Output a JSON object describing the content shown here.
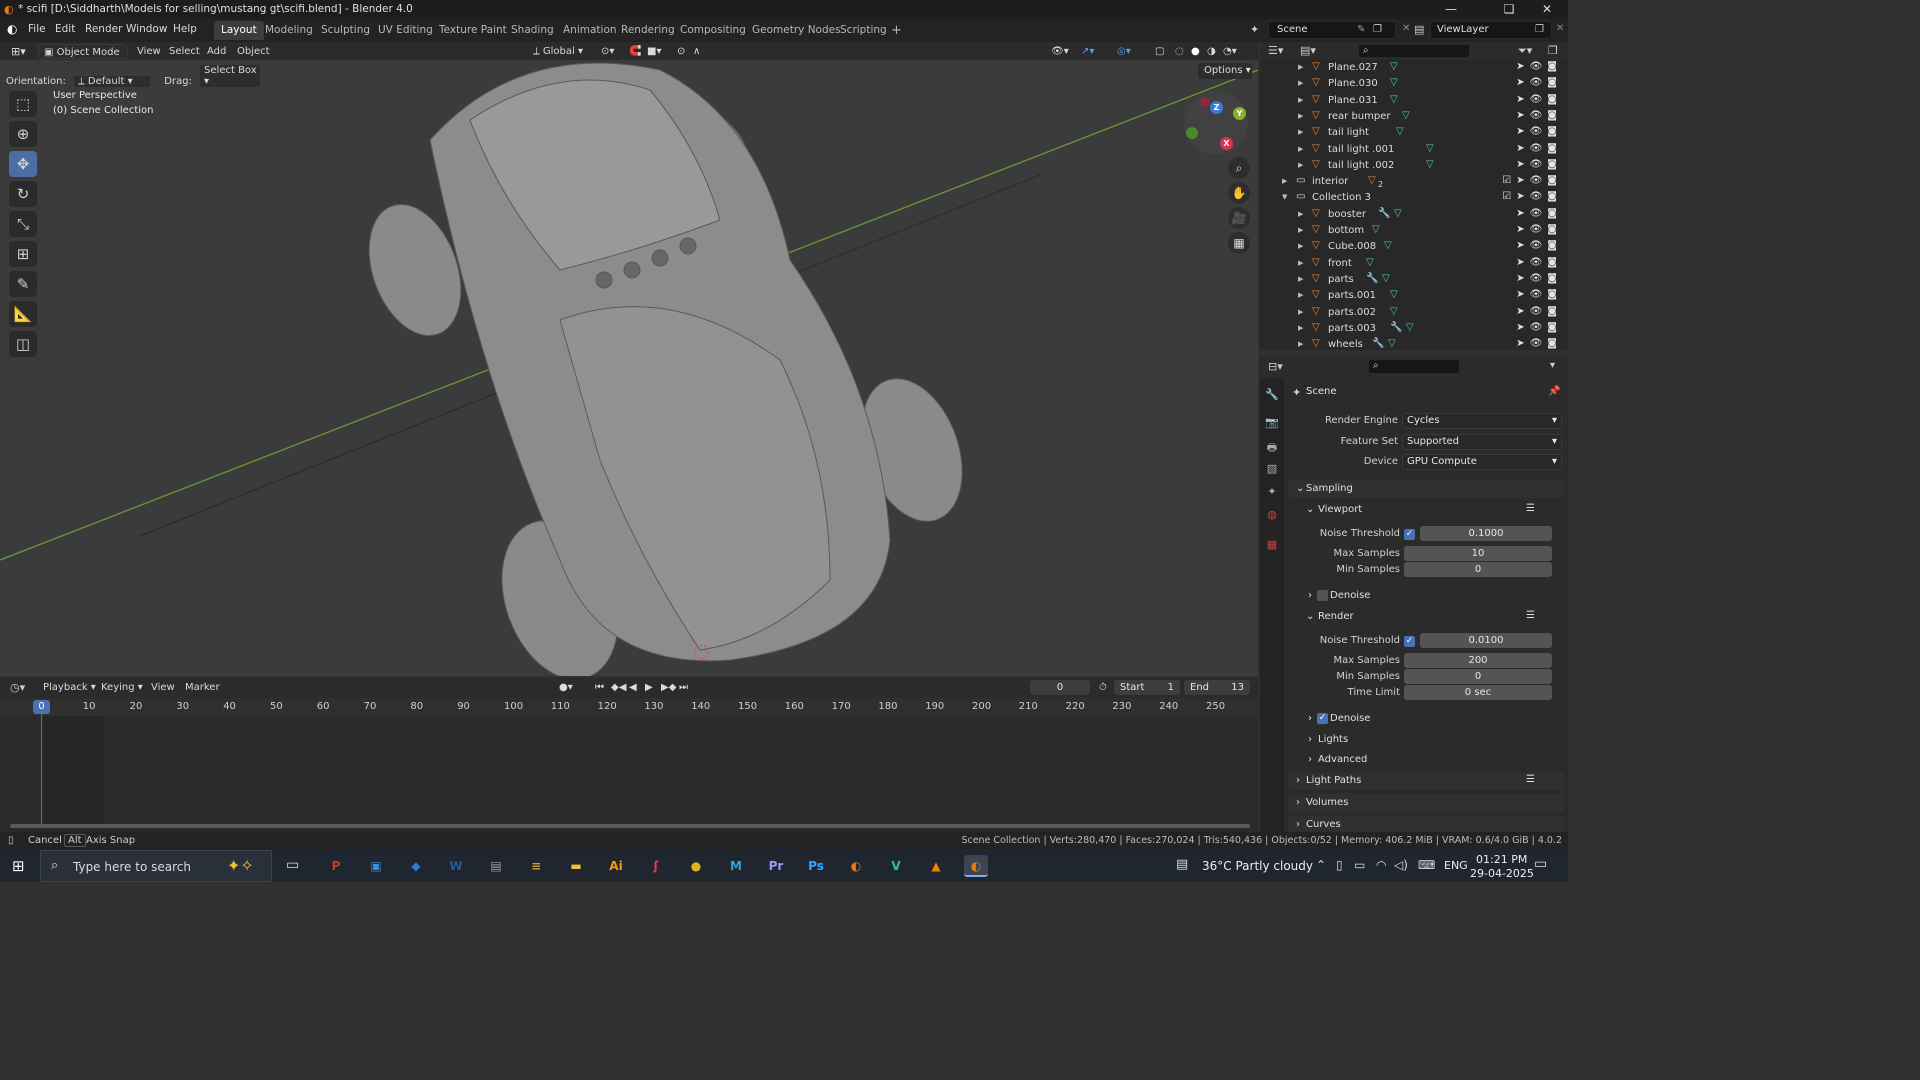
{
  "titlebar": {
    "title": "* scifi [D:\\Siddharth\\Models for selling\\mustang gt\\scifi.blend] - Blender 4.0"
  },
  "menu": {
    "items": [
      "File",
      "Edit",
      "Render",
      "Window",
      "Help"
    ]
  },
  "workspaces": {
    "tabs": [
      "Layout",
      "Modeling",
      "Sculpting",
      "UV Editing",
      "Texture Paint",
      "Shading",
      "Animation",
      "Rendering",
      "Compositing",
      "Geometry Nodes",
      "Scripting"
    ],
    "active": "Layout",
    "add": "+"
  },
  "scene": {
    "name": "Scene",
    "view_layer": "ViewLayer"
  },
  "viewport_header": {
    "mode": "Object Mode",
    "menus": [
      "View",
      "Select",
      "Add",
      "Object"
    ],
    "transform": "Global",
    "orientation_label": "Orientation:",
    "orientation": "Default",
    "drag_label": "Drag:",
    "drag": "Select Box",
    "options": "Options"
  },
  "viewport": {
    "perspective": "User Perspective",
    "collection": "(0) Scene Collection",
    "gizmo": {
      "x": "X",
      "y": "Y",
      "z": "Z"
    }
  },
  "outliner": {
    "rows": [
      {
        "name": "Plane.027",
        "indent": 2,
        "type": "mesh",
        "mod": false,
        "checkbox": false
      },
      {
        "name": "Plane.030",
        "indent": 2,
        "type": "mesh",
        "mod": false,
        "checkbox": false
      },
      {
        "name": "Plane.031",
        "indent": 2,
        "type": "mesh",
        "mod": false,
        "checkbox": false
      },
      {
        "name": "rear bumper",
        "indent": 2,
        "type": "mesh",
        "mod": false,
        "checkbox": false
      },
      {
        "name": "tail light",
        "indent": 2,
        "type": "mesh",
        "mod": false,
        "checkbox": false
      },
      {
        "name": "tail light .001",
        "indent": 2,
        "type": "mesh",
        "mod": false,
        "checkbox": false
      },
      {
        "name": "tail light .002",
        "indent": 2,
        "type": "mesh",
        "mod": false,
        "checkbox": false
      },
      {
        "name": "interior",
        "indent": 1,
        "type": "collection",
        "mod": false,
        "checkbox": true,
        "badge": "2"
      },
      {
        "name": "Collection 3",
        "indent": 1,
        "type": "collection",
        "mod": false,
        "checkbox": true,
        "open": true
      },
      {
        "name": "booster",
        "indent": 2,
        "type": "mesh",
        "mod": true,
        "checkbox": false
      },
      {
        "name": "bottom",
        "indent": 2,
        "type": "mesh",
        "mod": false,
        "checkbox": false
      },
      {
        "name": "Cube.008",
        "indent": 2,
        "type": "mesh",
        "mod": false,
        "checkbox": false
      },
      {
        "name": "front",
        "indent": 2,
        "type": "mesh",
        "mod": false,
        "checkbox": false
      },
      {
        "name": "parts",
        "indent": 2,
        "type": "mesh",
        "mod": true,
        "checkbox": false
      },
      {
        "name": "parts.001",
        "indent": 2,
        "type": "mesh",
        "mod": false,
        "checkbox": false
      },
      {
        "name": "parts.002",
        "indent": 2,
        "type": "mesh",
        "mod": false,
        "checkbox": false
      },
      {
        "name": "parts.003",
        "indent": 2,
        "type": "mesh",
        "mod": true,
        "checkbox": false
      },
      {
        "name": "wheels",
        "indent": 2,
        "type": "mesh",
        "mod": true,
        "checkbox": false
      }
    ]
  },
  "properties": {
    "context": "Scene",
    "render_engine_label": "Render Engine",
    "render_engine": "Cycles",
    "feature_set_label": "Feature Set",
    "feature_set": "Supported",
    "device_label": "Device",
    "device": "GPU Compute",
    "sampling": "Sampling",
    "viewport": "Viewport",
    "noise_threshold_label": "Noise Threshold",
    "max_samples_label": "Max Samples",
    "min_samples_label": "Min Samples",
    "time_limit_label": "Time Limit",
    "vp_noise": "0.1000",
    "vp_max": "10",
    "vp_min": "0",
    "denoise": "Denoise",
    "render": "Render",
    "r_noise": "0.0100",
    "r_max": "200",
    "r_min": "0",
    "r_time": "0 sec",
    "lights": "Lights",
    "advanced": "Advanced",
    "light_paths": "Light Paths",
    "volumes": "Volumes",
    "curves": "Curves"
  },
  "timeline": {
    "menus": [
      "Playback",
      "Keying",
      "View",
      "Marker"
    ],
    "current_frame": "0",
    "start_label": "Start",
    "start": "1",
    "end_label": "End",
    "end": "13",
    "ticks": [
      "0",
      "10",
      "20",
      "30",
      "40",
      "50",
      "60",
      "70",
      "80",
      "90",
      "100",
      "110",
      "120",
      "130",
      "140",
      "150",
      "160",
      "170",
      "180",
      "190",
      "200",
      "210",
      "220",
      "230",
      "240",
      "250"
    ]
  },
  "statusbar": {
    "cancel": "Cancel",
    "alt": "Alt",
    "axis_snap": "Axis Snap",
    "stats": "Scene Collection | Verts:280,470 | Faces:270,024 | Tris:540,436 | Objects:0/52 | Memory: 406.2 MiB | VRAM: 0.6/4.0 GiB | 4.0.2"
  },
  "taskbar": {
    "search_placeholder": "Type here to search",
    "weather": "36°C  Partly cloudy",
    "lang": "ENG",
    "time": "01:21 PM",
    "date": "29-04-2025",
    "apps": [
      {
        "name": "powerpoint",
        "glyph": "P",
        "color": "#c43e1c"
      },
      {
        "name": "explorer-alt",
        "glyph": "▣",
        "color": "#3a8fd8"
      },
      {
        "name": "app-blue",
        "glyph": "◆",
        "color": "#2d7bd6"
      },
      {
        "name": "word",
        "glyph": "W",
        "color": "#2b579a"
      },
      {
        "name": "app-photos",
        "glyph": "▤",
        "color": "#a0a0a0"
      },
      {
        "name": "app-layers",
        "glyph": "≡",
        "color": "#d0a030"
      },
      {
        "name": "file-explorer",
        "glyph": "▬",
        "color": "#f2c230"
      },
      {
        "name": "illustrator",
        "glyph": "Ai",
        "color": "#ff9a00"
      },
      {
        "name": "app-snake",
        "glyph": "ʃ",
        "color": "#e04040"
      },
      {
        "name": "chrome",
        "glyph": "●",
        "color": "#e0b020"
      },
      {
        "name": "microsoft-365",
        "glyph": "M",
        "color": "#3a9ee0"
      },
      {
        "name": "premiere",
        "glyph": "Pr",
        "color": "#9999ff"
      },
      {
        "name": "photoshop",
        "glyph": "Ps",
        "color": "#31a8ff"
      },
      {
        "name": "blender",
        "glyph": "◐",
        "color": "#e87d0d"
      },
      {
        "name": "app-v",
        "glyph": "V",
        "color": "#30c0b0"
      },
      {
        "name": "vlc",
        "glyph": "▲",
        "color": "#f08000"
      },
      {
        "name": "blender-active",
        "glyph": "◐",
        "color": "#e87d0d"
      }
    ]
  }
}
